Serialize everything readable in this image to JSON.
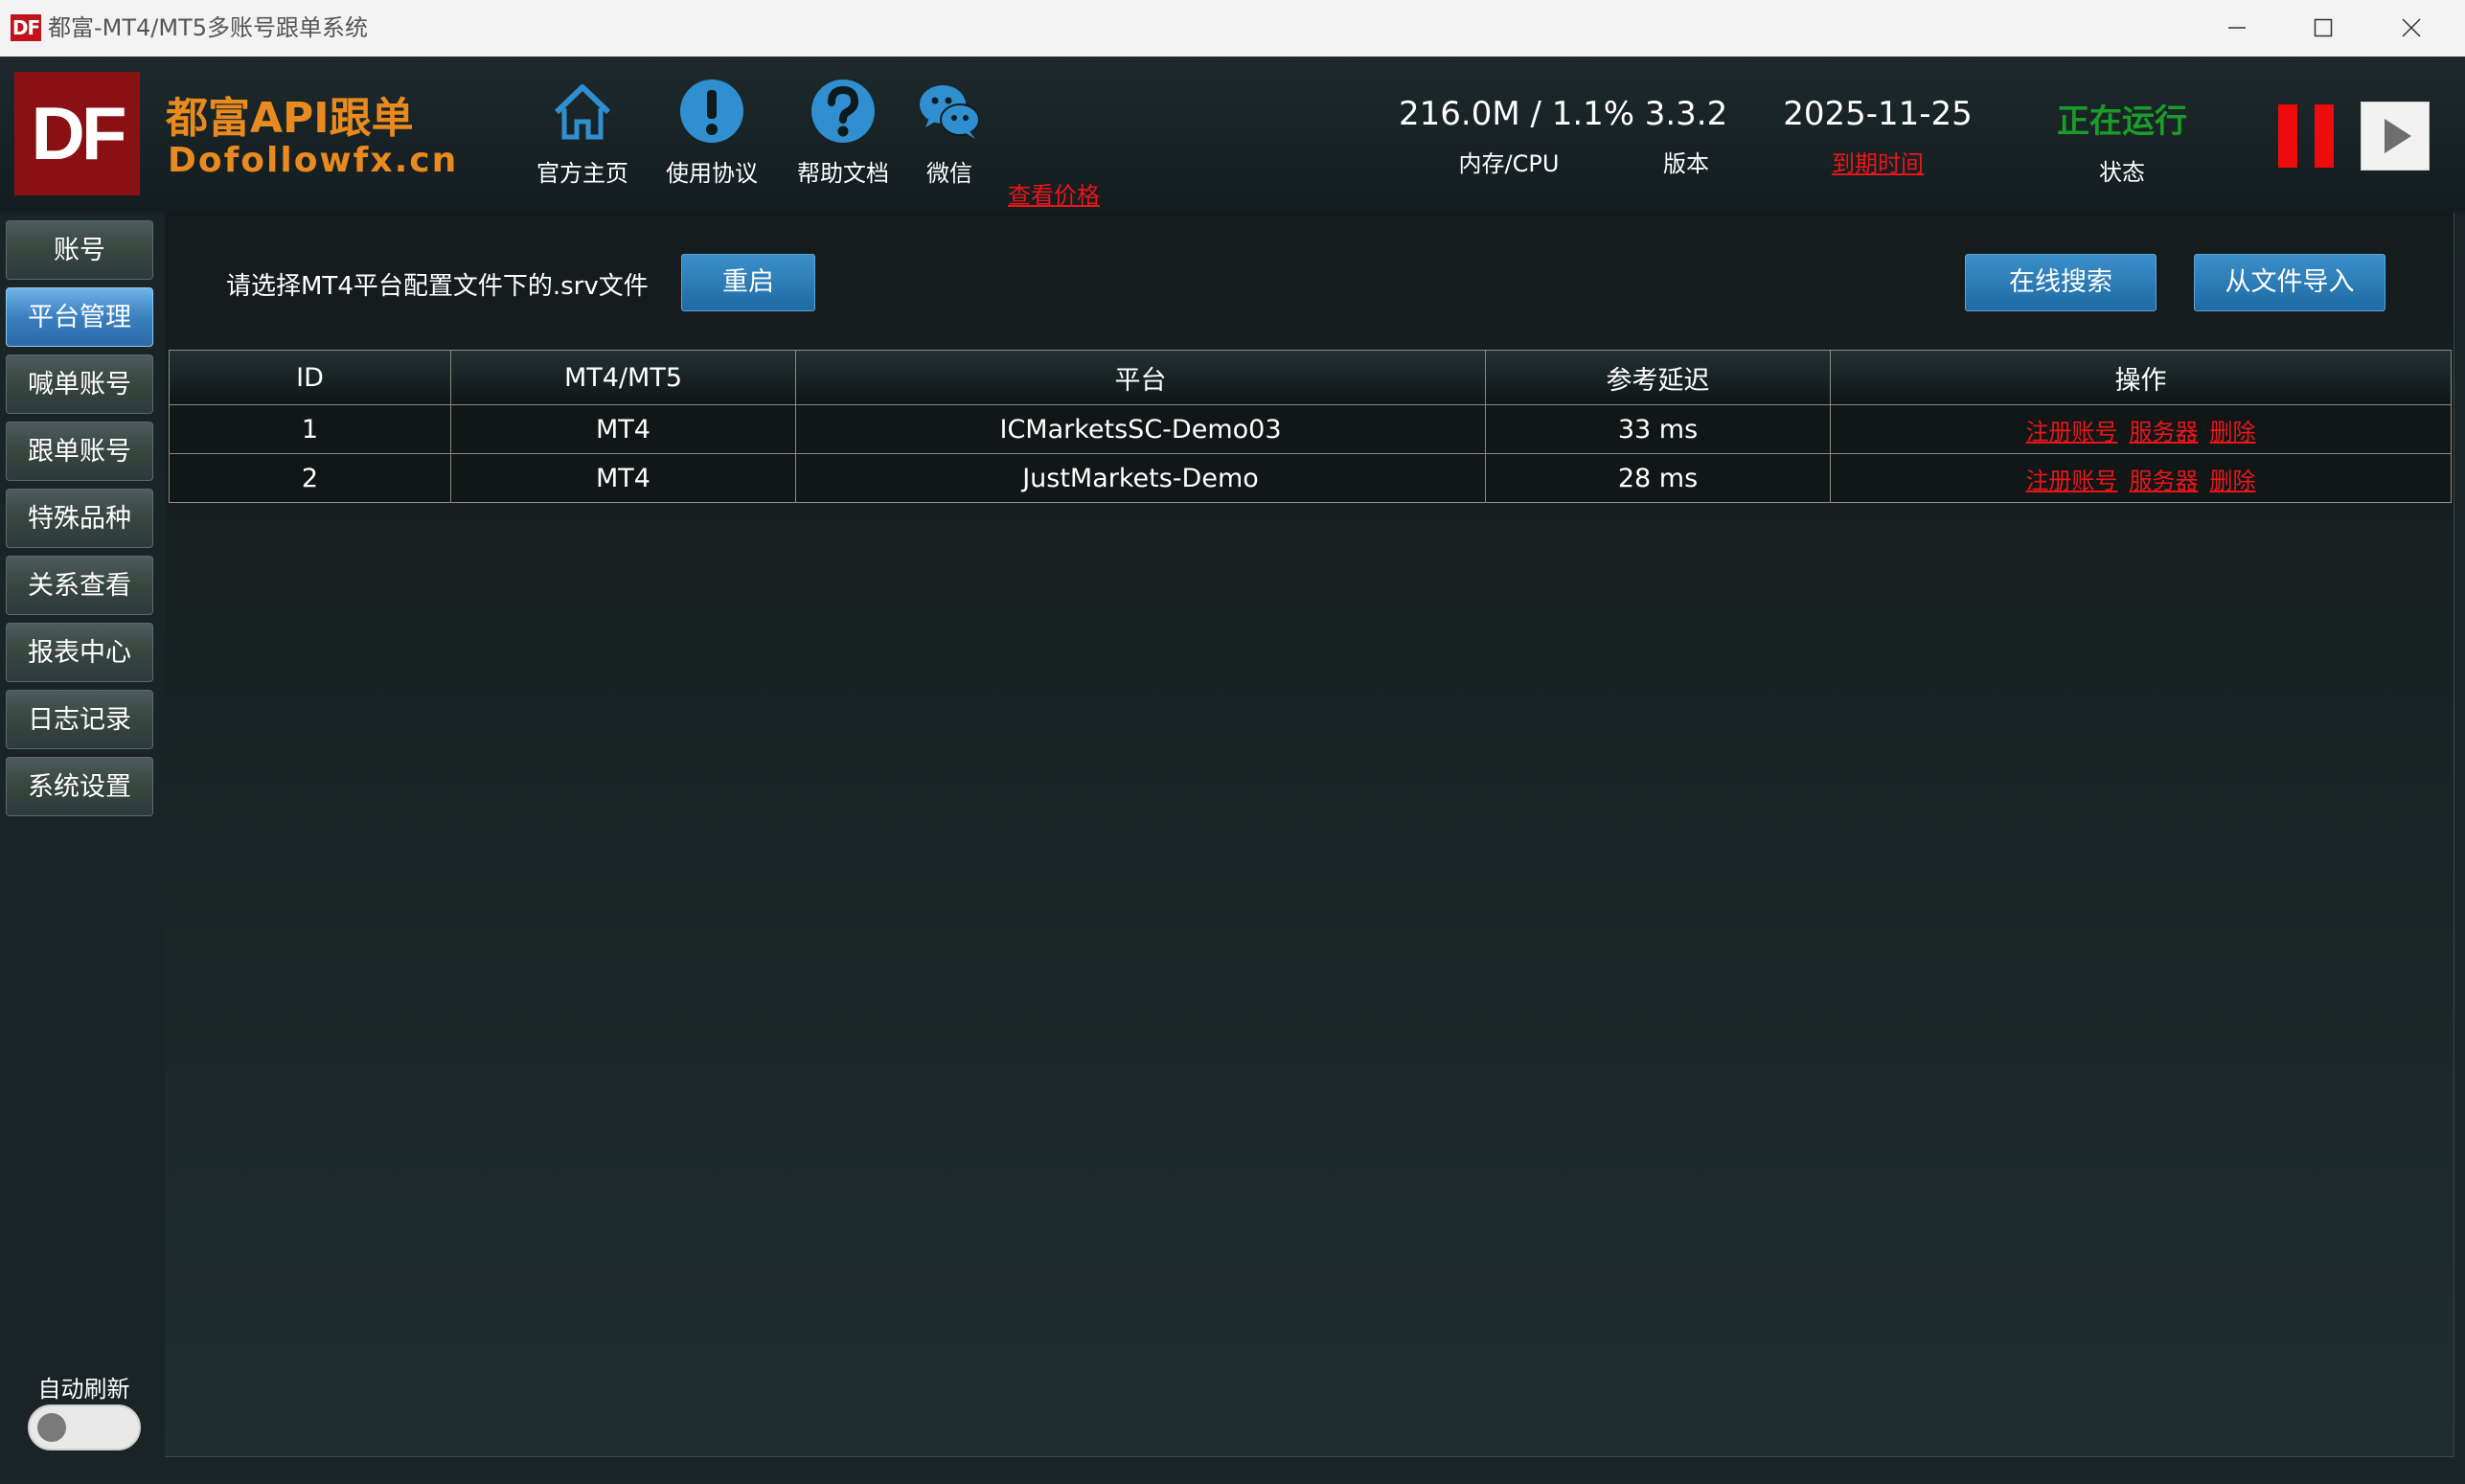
{
  "window": {
    "logo": "DF",
    "title": "都富-MT4/MT5多账号跟单系统"
  },
  "header": {
    "logo": "DF",
    "brand_cn": "都富API跟单",
    "brand_url": "Dofollowfx.cn",
    "nav": [
      {
        "label": "官方主页",
        "icon": "home-icon"
      },
      {
        "label": "使用协议",
        "icon": "exclamation-icon"
      },
      {
        "label": "帮助文档",
        "icon": "question-icon"
      },
      {
        "label": "微信",
        "icon": "wechat-icon"
      }
    ],
    "price_link": "查看价格",
    "stats": {
      "memory_cpu": {
        "value": "216.0M / 1.1%",
        "label": "内存/CPU"
      },
      "version": {
        "value": "3.3.2",
        "label": "版本"
      },
      "expiry": {
        "value": "2025-11-25",
        "label": "到期时间"
      },
      "status": {
        "value": "正在运行",
        "label": "状态"
      }
    },
    "colors": {
      "brand": "#e88a1f",
      "running": "#1a9c2a",
      "alert": "#e8161a"
    }
  },
  "sidebar": {
    "items": [
      {
        "label": "账号",
        "active": false
      },
      {
        "label": "平台管理",
        "active": true
      },
      {
        "label": "喊单账号",
        "active": false
      },
      {
        "label": "跟单账号",
        "active": false
      },
      {
        "label": "特殊品种",
        "active": false
      },
      {
        "label": "关系查看",
        "active": false
      },
      {
        "label": "报表中心",
        "active": false
      },
      {
        "label": "日志记录",
        "active": false
      },
      {
        "label": "系统设置",
        "active": false
      }
    ],
    "auto_refresh_label": "自动刷新",
    "auto_refresh_on": false
  },
  "main": {
    "prompt": "请选择MT4平台配置文件下的.srv文件",
    "restart_label": "重启",
    "online_search_label": "在线搜索",
    "import_file_label": "从文件导入",
    "table": {
      "columns": [
        "ID",
        "MT4/MT5",
        "平台",
        "参考延迟",
        "操作"
      ],
      "rows": [
        {
          "id": "1",
          "type": "MT4",
          "platform": "ICMarketsSC-Demo03",
          "latency": "33 ms"
        },
        {
          "id": "2",
          "type": "MT4",
          "platform": "JustMarkets-Demo",
          "latency": "28 ms"
        }
      ],
      "actions": [
        "注册账号",
        "服务器",
        "删除"
      ]
    }
  }
}
